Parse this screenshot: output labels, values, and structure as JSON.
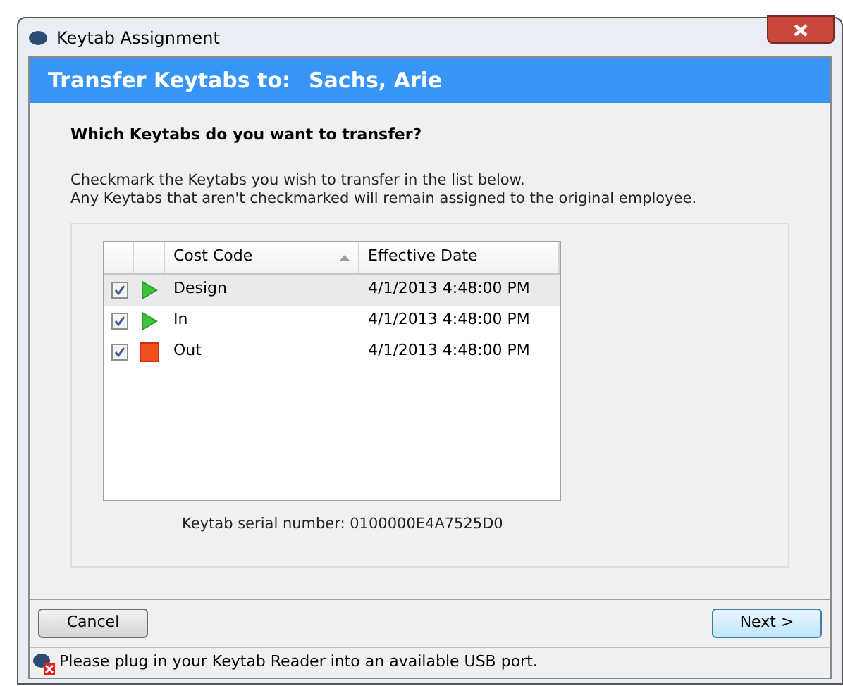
{
  "window": {
    "title": "Keytab Assignment"
  },
  "header": {
    "label": "Transfer Keytabs to:",
    "name": "Sachs, Arie"
  },
  "question": "Which Keytabs do you want to transfer?",
  "instructions": [
    "Checkmark the Keytabs you wish to transfer in the list below.",
    "Any Keytabs that aren't checkmarked will remain assigned to the original employee."
  ],
  "table": {
    "columns": [
      "Cost Code",
      "Effective Date"
    ],
    "rows": [
      {
        "kind": "play",
        "checked": true,
        "selected": true,
        "cost_code": "Design",
        "effective_date": "4/1/2013 4:48:00 PM"
      },
      {
        "kind": "play",
        "checked": true,
        "selected": false,
        "cost_code": "In",
        "effective_date": "4/1/2013 4:48:00 PM"
      },
      {
        "kind": "stop",
        "checked": true,
        "selected": false,
        "cost_code": "Out",
        "effective_date": "4/1/2013 4:48:00 PM"
      }
    ]
  },
  "serial": "Keytab serial number: 0100000E4A7525D0",
  "buttons": {
    "cancel": "Cancel",
    "next": "Next >"
  },
  "status_bar": "Please plug in your Keytab Reader into an available USB port."
}
